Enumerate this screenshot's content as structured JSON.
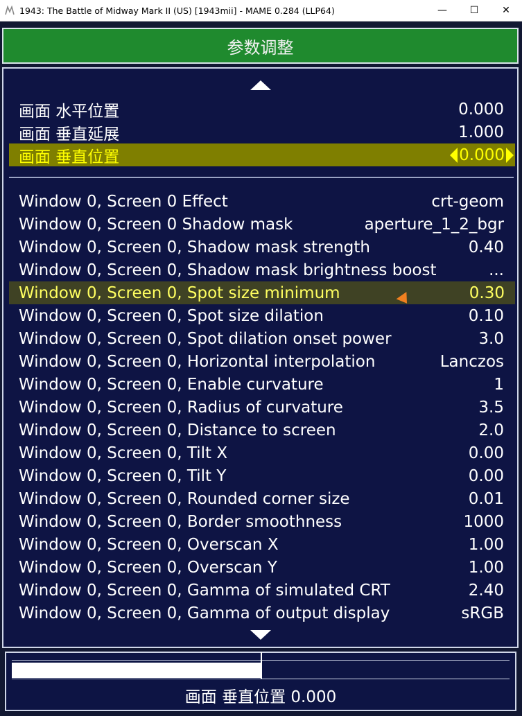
{
  "window": {
    "title": "1943: The Battle of Midway Mark II (US) [1943mii] - MAME 0.284 (LLP64)",
    "minimize_glyph": "—",
    "maximize_glyph": "☐",
    "close_glyph": "✕",
    "app_icon": "mame-icon"
  },
  "menu": {
    "title": "参数调整",
    "scroll_up_icon": "triangle-up-icon",
    "scroll_down_icon": "triangle-down-icon",
    "top_items": [
      {
        "label": "画面 水平位置",
        "value": "0.000"
      },
      {
        "label": "画面 垂直延展",
        "value": "1.000"
      },
      {
        "label": "画面 垂直位置",
        "value": "0.000"
      }
    ],
    "items": [
      {
        "label": "Window 0, Screen 0 Effect",
        "value": "crt-geom"
      },
      {
        "label": "Window 0, Screen 0 Shadow mask",
        "value": "aperture_1_2_bgr"
      },
      {
        "label": "Window 0, Screen 0, Shadow mask strength",
        "value": "0.40"
      },
      {
        "label": "Window 0, Screen 0, Shadow mask brightness boost",
        "value": "..."
      },
      {
        "label": "Window 0, Screen 0, Spot size minimum",
        "value": "0.30"
      },
      {
        "label": "Window 0, Screen 0, Spot size dilation",
        "value": "0.10"
      },
      {
        "label": "Window 0, Screen 0, Spot dilation onset power",
        "value": "3.0"
      },
      {
        "label": "Window 0, Screen 0, Horizontal interpolation",
        "value": "Lanczos"
      },
      {
        "label": "Window 0, Screen 0, Enable curvature",
        "value": "1"
      },
      {
        "label": "Window 0, Screen 0, Radius of curvature",
        "value": "3.5"
      },
      {
        "label": "Window 0, Screen 0, Distance to screen",
        "value": "2.0"
      },
      {
        "label": "Window 0, Screen 0, Tilt X",
        "value": "0.00"
      },
      {
        "label": "Window 0, Screen 0, Tilt Y",
        "value": "0.00"
      },
      {
        "label": "Window 0, Screen 0, Rounded corner size",
        "value": "0.01"
      },
      {
        "label": "Window 0, Screen 0, Border smoothness",
        "value": "1000"
      },
      {
        "label": "Window 0, Screen 0, Overscan X",
        "value": "1.00"
      },
      {
        "label": "Window 0, Screen 0, Overscan Y",
        "value": "1.00"
      },
      {
        "label": "Window 0, Screen 0, Gamma of simulated CRT",
        "value": "2.40"
      },
      {
        "label": "Window 0, Screen 0, Gamma of output display",
        "value": "sRGB"
      }
    ]
  },
  "slider": {
    "label": "画面 垂直位置 0.000",
    "fill_fraction": 0.5
  },
  "colors": {
    "header_green": "#1f8a2e",
    "panel_navy": "#0e1446",
    "selected_yellow": "#ffff00",
    "selected_bg": "#7f7f00",
    "cursor_orange": "#f08020"
  }
}
